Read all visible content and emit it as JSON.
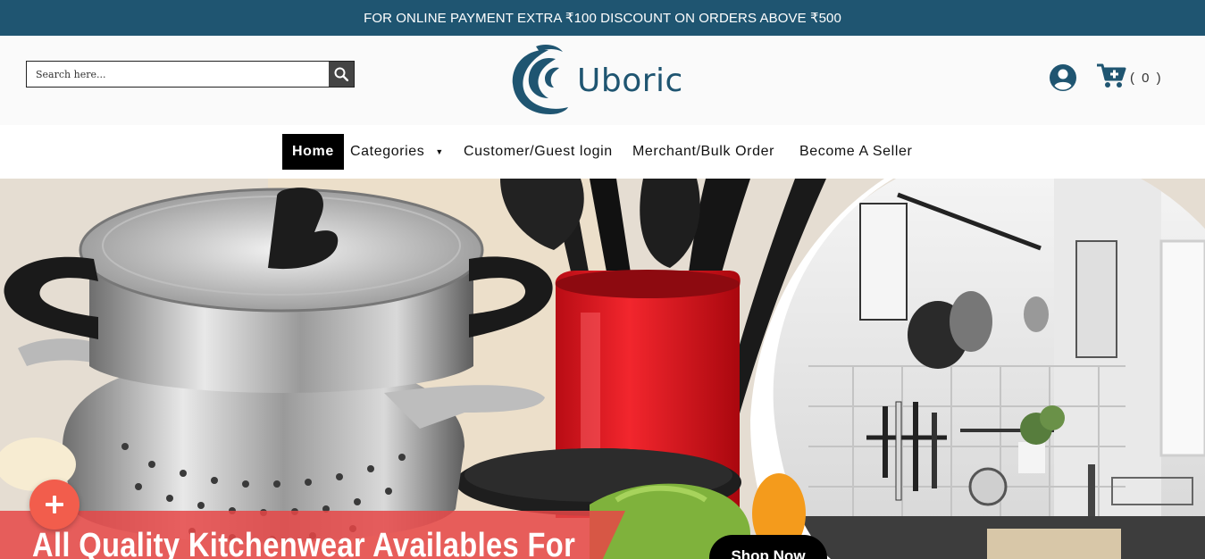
{
  "announcement": "FOR ONLINE PAYMENT EXTRA ₹100 DISCOUNT ON ORDERS ABOVE ₹500",
  "search": {
    "placeholder": "Search here..."
  },
  "brand": {
    "name": "Uboric"
  },
  "cart": {
    "count_label": "( 0 )"
  },
  "nav": {
    "home": "Home",
    "categories": "Categories",
    "customer_login": "Customer/Guest login",
    "merchant": "Merchant/Bulk Order",
    "seller": "Become A Seller"
  },
  "hero": {
    "heading": "All Quality Kitchenwear Availables For",
    "cta": "Shop Now"
  },
  "colors": {
    "brand": "#1f5571",
    "accent": "#f25d4c",
    "nav_active": "#000000"
  },
  "icons": [
    "search-icon",
    "user-icon",
    "cart-icon",
    "plus-icon",
    "caret-down-icon"
  ]
}
